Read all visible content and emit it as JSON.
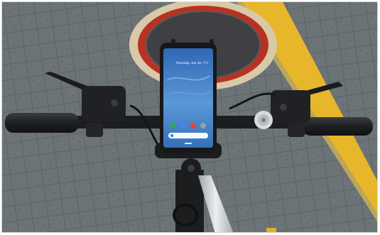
{
  "scene": {
    "description_type": "photo",
    "subject": "bicycle handlebar with smartphone mount"
  },
  "phone_screen": {
    "date_text": "Thursday, Jan 28, 7°C",
    "status_time": "",
    "dock_icons": [
      "phone-app-icon",
      "messages-app-icon",
      "chrome-app-icon",
      "camera-app-icon"
    ],
    "search_bar_icon": "google-g-icon"
  },
  "colors": {
    "pavement": "#5f6568",
    "tile_line": "#4a4f52",
    "yellow_stripe": "#e8b62a",
    "manhole_red": "#b83224",
    "manhole_ring": "#d8c9a8",
    "phone_screen": "#3f7fc9",
    "bike_black": "#1c1d1f",
    "fork_silver": "#c9ccd0"
  }
}
